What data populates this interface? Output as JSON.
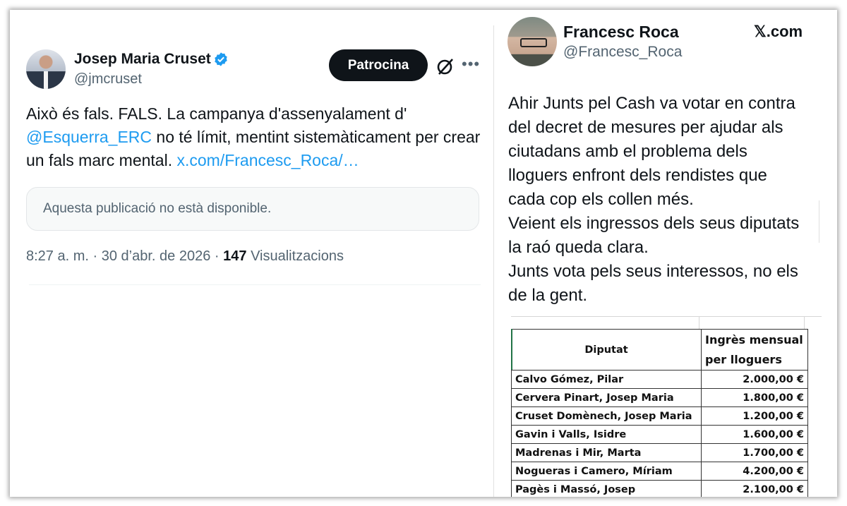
{
  "left_tweet": {
    "author_name": "Josep Maria Cruset",
    "handle": "@jmcruset",
    "sponsor_button": "Patrocina",
    "text_part1": "Això és fals. FALS.  La campanya d'assenyalament d' ",
    "mention": "@Esquerra_ERC",
    "text_part2": " no té límit, mentint sistemàticament per crear un fals marc mental. ",
    "link": "x.com/Francesc_Roca/…",
    "quoted_unavailable": "Aquesta publicació no està disponible.",
    "time": "8:27 a. m.",
    "date": "30 d’abr. de 2026",
    "views_count": "147",
    "views_label": "Visualitzacions",
    "accent_color": "#1d9bf0",
    "icons": [
      "verified-badge-icon",
      "grok-icon",
      "more-icon"
    ]
  },
  "right_tweet": {
    "author_name": "Francesc Roca",
    "handle": "@Francesc_Roca",
    "site": "𝕏.com",
    "lines": [
      "Ahir Junts pel Cash va votar en contra",
      "del decret de mesures per ajudar als",
      "ciutadans amb el problema dels",
      "lloguers enfront dels rendistes que",
      "cada cop els collen més.",
      "Veient els ingressos dels seus diputats",
      "la raó queda clara.",
      "Junts vota pels seus interessos, no els",
      "de la gent."
    ],
    "table": {
      "headers": [
        "Diputat",
        "Ingrès mensual per lloguers"
      ],
      "rows": [
        [
          "Calvo Gómez, Pilar",
          "2.000,00 €"
        ],
        [
          "Cervera Pinart, Josep Maria",
          "1.800,00 €"
        ],
        [
          "Cruset Domènech, Josep Maria",
          "1.200,00 €"
        ],
        [
          "Gavin i Valls, Isidre",
          "1.600,00 €"
        ],
        [
          "Madrenas i Mir, Marta",
          "1.700,00 €"
        ],
        [
          "Nogueras i Camero, Míriam",
          "4.200,00 €"
        ],
        [
          "Pagès i Massó, Josep",
          "2.100,00 €"
        ]
      ]
    }
  }
}
